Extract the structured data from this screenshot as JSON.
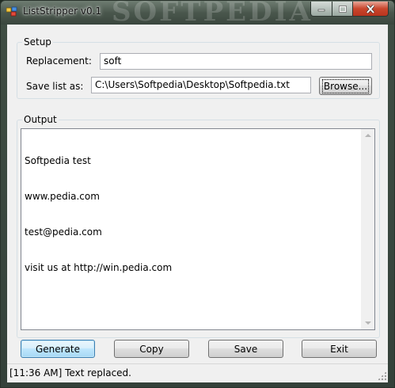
{
  "window": {
    "title": "ListStripper v0.1",
    "watermark": "SOFTPEDIA"
  },
  "setup": {
    "legend": "Setup",
    "replacement_label": "Replacement:",
    "replacement_value": "soft",
    "save_label": "Save list as:",
    "save_value": "C:\\Users\\Softpedia\\Desktop\\Softpedia.txt",
    "browse_label": "Browse..."
  },
  "output": {
    "legend": "Output",
    "lines": [
      "Softpedia test",
      "www.pedia.com",
      "test@pedia.com",
      "visit us at http://win.pedia.com"
    ]
  },
  "buttons": {
    "generate": "Generate",
    "copy": "Copy",
    "save": "Save",
    "exit": "Exit"
  },
  "status": {
    "text": "[11:36 AM] Text replaced."
  }
}
